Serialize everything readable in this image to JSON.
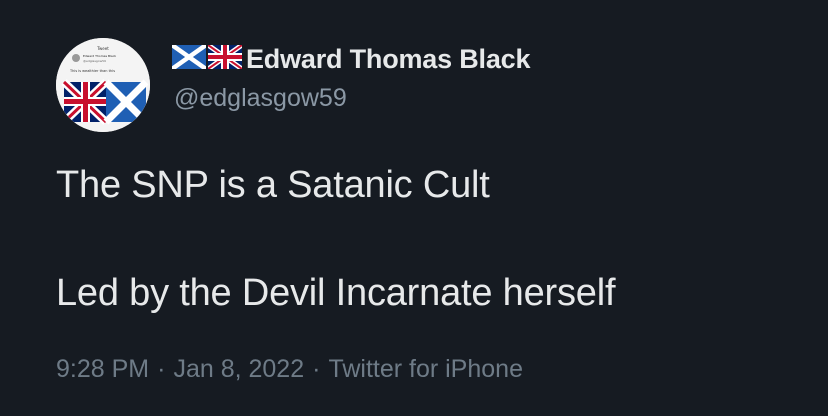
{
  "author": {
    "display_name": "Edward Thomas Black",
    "handle": "@edglasgow59",
    "flags": [
      "scotland-flag-icon",
      "uk-flag-icon"
    ],
    "avatar": {
      "header_text": "Tweet",
      "name_text": "Edward Thomas Black",
      "handle_text": "@edglasgow59",
      "tweet_text": "This is wealthier than this"
    }
  },
  "tweet": {
    "lines": [
      "The SNP is a Satanic Cult",
      "Led by the Devil Incarnate herself"
    ],
    "time": "9:28 PM",
    "separator_1": "·",
    "date": "Jan 8, 2022",
    "separator_2": "·",
    "source": "Twitter for iPhone"
  },
  "colors": {
    "background": "#161b22",
    "primary_text": "#e7e9ea",
    "secondary_text": "#8b98a5",
    "meta_text": "#6e7b87",
    "saltire_blue": "#1f5fb4",
    "union_red": "#c8102e",
    "union_blue": "#012169"
  }
}
